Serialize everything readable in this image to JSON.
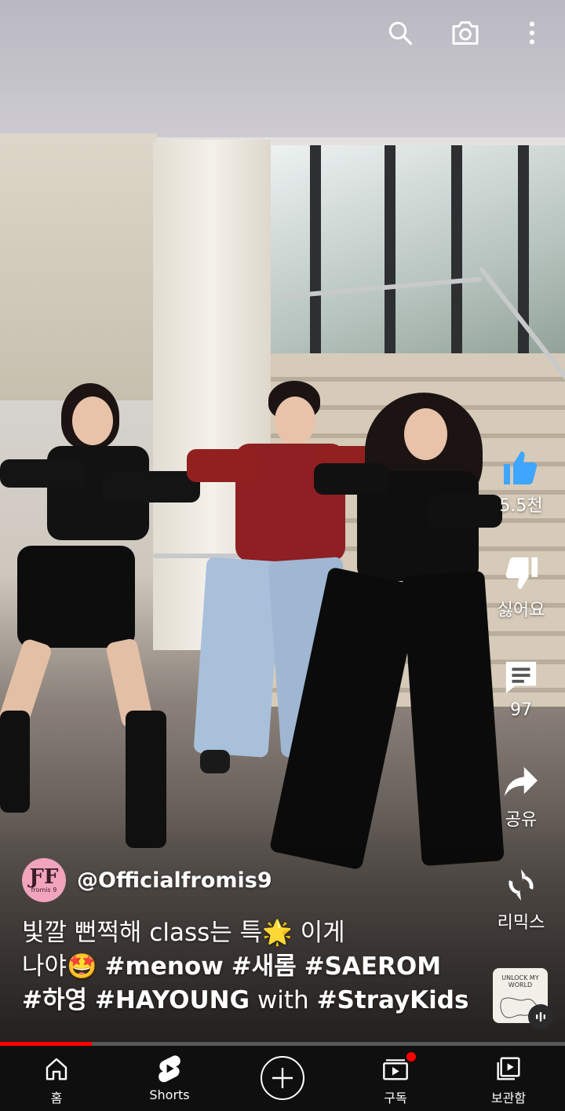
{
  "top_bar": {
    "search_icon": "search-icon",
    "camera_icon": "camera-icon",
    "more_icon": "more-vert-icon"
  },
  "actions": {
    "like_count": "5.5천",
    "dislike_label": "싫어요",
    "comment_count": "97",
    "share_label": "공유",
    "remix_label": "리믹스"
  },
  "channel": {
    "avatar_text": "ƑF",
    "avatar_sub": "fromis 9",
    "handle": "@Officialfromis9"
  },
  "caption": {
    "line1_text": "빛깔 뻔쩍해 class는 특",
    "line1_emoji": "🌟",
    "line1_end": " 이게",
    "line2_text": "나야",
    "line2_emoji": "🤩",
    "tag_menow": "#menow",
    "tag_saerom_kr": "#새롬",
    "tag_saerom": "#SAEROM",
    "tag_hayoung_kr": "#하영",
    "tag_hayoung": "#HAYOUNG",
    "with_text": "with",
    "tag_straykids": "#StrayKids"
  },
  "sound": {
    "thumb_text": "UNLOCK MY WORLD"
  },
  "progress": {
    "fraction": 0.163
  },
  "nav": {
    "home_label": "홈",
    "shorts_label": "Shorts",
    "subscriptions_label": "구독",
    "library_label": "보관함"
  },
  "colors": {
    "accent": "#ff0000",
    "like_active": "#3ea6ff",
    "nav_bg": "#0f0f0f"
  }
}
